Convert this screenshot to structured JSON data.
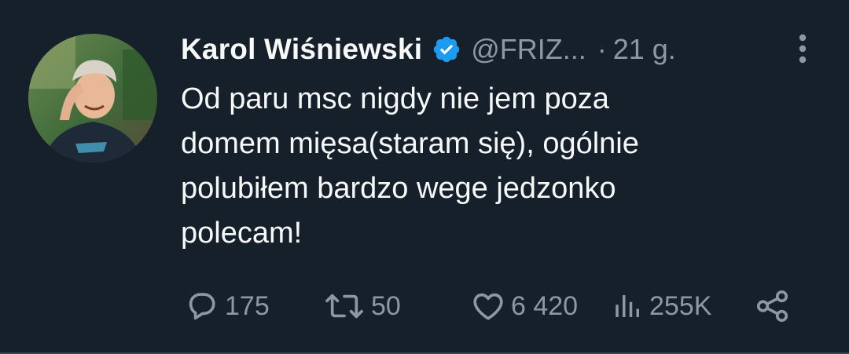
{
  "tweet": {
    "author_name": "Karol Wiśniewski",
    "verified": true,
    "handle": "@FRIZ...",
    "separator": "·",
    "time": "21 g.",
    "text_lines": [
      "Od paru msc nigdy nie jem poza",
      "domem mięsa(staram się), ogólnie",
      "polubiłem bardzo wege jedzonko",
      "polecam!"
    ],
    "stats": {
      "replies": "175",
      "retweets": "50",
      "likes": "6 420",
      "views": "255K"
    }
  },
  "icons": {
    "verified": "verified-badge-icon",
    "more": "more-vertical-icon",
    "reply": "reply-icon",
    "retweet": "retweet-icon",
    "like": "heart-icon",
    "views": "views-icon",
    "share": "share-icon"
  },
  "colors": {
    "background": "#15202b",
    "text": "#f7f9f9",
    "secondary": "#8b98a5",
    "verified": "#1d9bf0"
  }
}
